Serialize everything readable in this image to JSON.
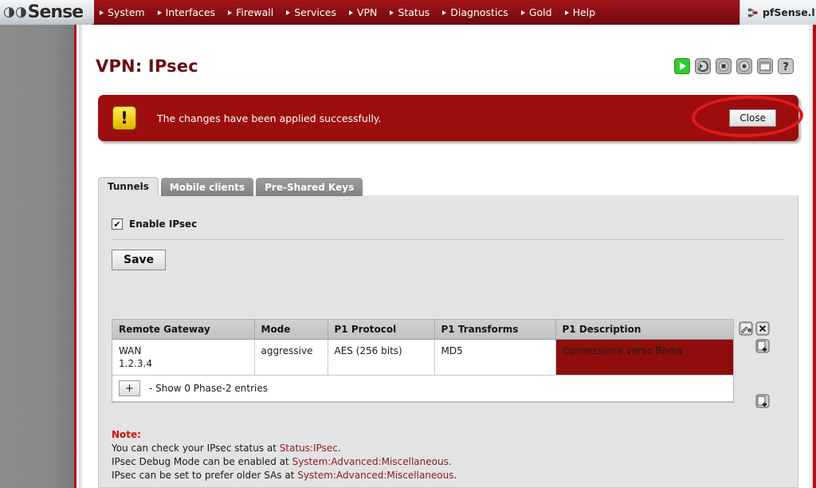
{
  "browser": {
    "tab_title": "pfSense.l",
    "favicon": "pfsense-favicon-icon"
  },
  "brand": {
    "logo_text": "Sense",
    "logo_accent": "s",
    "logo_rings": "∞"
  },
  "nav": {
    "items": [
      {
        "label": "System"
      },
      {
        "label": "Interfaces"
      },
      {
        "label": "Firewall"
      },
      {
        "label": "Services"
      },
      {
        "label": "VPN"
      },
      {
        "label": "Status"
      },
      {
        "label": "Diagnostics"
      },
      {
        "label": "Gold"
      },
      {
        "label": "Help"
      }
    ]
  },
  "header": {
    "page_title": "VPN: IPsec"
  },
  "status_icons": [
    {
      "name": "start-service-icon",
      "state": "enabled"
    },
    {
      "name": "restart-service-icon",
      "state": "disabled"
    },
    {
      "name": "stop-service-icon",
      "state": "disabled"
    },
    {
      "name": "service-status-icon",
      "state": "disabled"
    },
    {
      "name": "log-window-icon",
      "state": "disabled"
    },
    {
      "name": "help-icon",
      "state": "disabled",
      "glyph": "?"
    }
  ],
  "alert": {
    "icon": "warning-exclamation-icon",
    "icon_glyph": "!",
    "message": "The changes have been applied successfully.",
    "close_label": "Close",
    "background_color": "#9d0d0d",
    "annotation": "red-ellipse-highlight"
  },
  "tabs": [
    {
      "label": "Tunnels",
      "active": true
    },
    {
      "label": "Mobile clients",
      "active": false
    },
    {
      "label": "Pre-Shared Keys",
      "active": false
    }
  ],
  "form": {
    "enable_ipsec_label": "Enable IPsec",
    "enable_ipsec_checked": true,
    "checkmark": "✔",
    "save_label": "Save"
  },
  "table": {
    "columns": [
      "Remote Gateway",
      "Mode",
      "P1 Protocol",
      "P1 Transforms",
      "P1 Description"
    ],
    "rows": [
      {
        "gateway_interface": "WAN",
        "gateway_address": "1.2.3.4",
        "mode": "aggressive",
        "p1_protocol": "AES (256 bits)",
        "p1_transforms": "MD5",
        "p1_description": "Connessione verso Roma",
        "description_bg": "#8f0d0d"
      }
    ],
    "phase2": {
      "expand_label": "+",
      "text": "- Show 0 Phase-2 entries"
    },
    "row_actions": [
      {
        "name": "edit-tunnel-icon",
        "glyph": "e"
      },
      {
        "name": "delete-tunnel-icon",
        "glyph": "✕"
      },
      {
        "name": "add-phase2-icon",
        "glyph": "+"
      }
    ],
    "add_tunnel_icon": {
      "name": "add-tunnel-icon",
      "glyph": "+"
    }
  },
  "note": {
    "heading": "Note:",
    "line1_pre": "You can check your IPsec status at ",
    "line1_link": "Status:IPsec",
    "line1_post": ".",
    "line2_pre": "IPsec Debug Mode can be enabled at ",
    "line2_link": "System:Advanced:Miscellaneous",
    "line2_post": ".",
    "line3_pre": "IPsec can be set to prefer older SAs at ",
    "line3_link": "System:Advanced:Miscellaneous",
    "line3_post": "."
  }
}
